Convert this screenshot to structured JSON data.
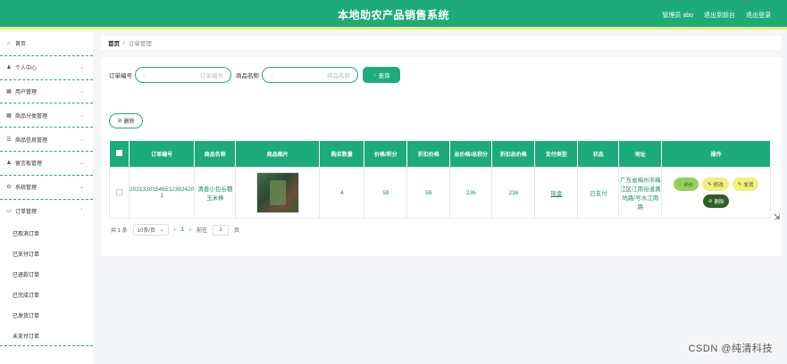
{
  "app": {
    "title": "本地助农产品销售系统"
  },
  "topbar": {
    "user": "管理员 abo",
    "back": "退出到前台",
    "logout": "退出登录"
  },
  "sidebar": {
    "items": [
      {
        "label": "首页",
        "icon": "home-icon",
        "glyph": "⌂"
      },
      {
        "label": "个人中心",
        "icon": "user-icon",
        "glyph": "♟"
      },
      {
        "label": "用户管理",
        "icon": "users-icon",
        "glyph": "▦"
      },
      {
        "label": "商品分类管理",
        "icon": "grid-icon",
        "glyph": "▦"
      },
      {
        "label": "商品信息管理",
        "icon": "list-icon",
        "glyph": "☰"
      },
      {
        "label": "留言板管理",
        "icon": "user-icon",
        "glyph": "♟"
      },
      {
        "label": "系统管理",
        "icon": "settings-icon",
        "glyph": "⚙"
      },
      {
        "label": "订单管理",
        "icon": "monitor-icon",
        "glyph": "▭"
      }
    ],
    "sub": [
      "已取消订单",
      "已支付订单",
      "已退款订单",
      "已完成订单",
      "已发货订单",
      "未支付订单"
    ]
  },
  "breadcrumb": {
    "home": "首页",
    "sep": "/",
    "current": "订单管理"
  },
  "search": {
    "order_label": "订单编号",
    "order_placeholder": "订单编号",
    "name_label": "商品名称",
    "name_placeholder": "商品名称",
    "query": "查询"
  },
  "delete_label": "删除",
  "table": {
    "headers": [
      "订单编号",
      "商品名称",
      "商品图片",
      "购买数量",
      "价格/积分",
      "折扣价格",
      "总价格/总积分",
      "折扣总价格",
      "支付类型",
      "状态",
      "地址",
      "操作"
    ],
    "rows": [
      {
        "order_no": "20213301546512392420 1",
        "name": "清香小包谷糯玉米棒",
        "qty": "4",
        "price": "59",
        "discount": "59",
        "total": "236",
        "discount_total": "236",
        "pay": "现金",
        "status": "已支付",
        "address": "广东省梅州市梅江区江南街道黄坑路/号水江南路"
      }
    ],
    "ops": {
      "review": "评价",
      "edit": "修改",
      "ship": "发货",
      "del": "删除"
    }
  },
  "pager": {
    "total": "共 1 条",
    "size": "10条/页",
    "page": "1",
    "goto": "前往",
    "goto_val": "1",
    "unit": "页"
  },
  "watermark": "CSDN @纯清科技",
  "colors": {
    "primary": "#1dab7b",
    "accent": "#e7f27a"
  }
}
